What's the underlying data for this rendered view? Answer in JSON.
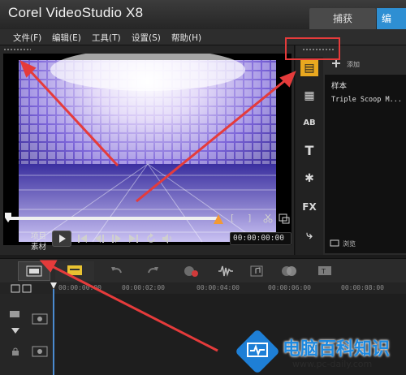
{
  "app": {
    "title": "Corel VideoStudio X8"
  },
  "top_tabs": {
    "capture": "捕获",
    "edit": "编"
  },
  "menu": {
    "items": [
      "文件(F)",
      "编辑(E)",
      "工具(T)",
      "设置(S)",
      "帮助(H)"
    ]
  },
  "preview": {
    "mode_project": "项目",
    "mode_clip": "素材",
    "bracket_open": "[",
    "bracket_close": "]",
    "timecode": "00:00:00:00"
  },
  "library": {
    "add_label": "添加",
    "folder_name": "样本",
    "clip_name": "Triple Scoop M...",
    "browse_label": "浏览",
    "icons": [
      "media-icon",
      "instant-project-icon",
      "transition-icon",
      "title-icon",
      "graphic-icon",
      "filter-icon",
      "path-icon"
    ]
  },
  "timeline": {
    "ruler": [
      "00:00:00:00",
      "00:00:02:00",
      "00:00:04:00",
      "00:00:06:00",
      "00:00:08:00"
    ]
  },
  "watermark": {
    "title": "电脑百科知识",
    "url": "www.pc-daily.com"
  },
  "colors": {
    "accent": "#2e8fd3",
    "annotation": "#e53b3b",
    "watermark": "#1f8ae0"
  }
}
